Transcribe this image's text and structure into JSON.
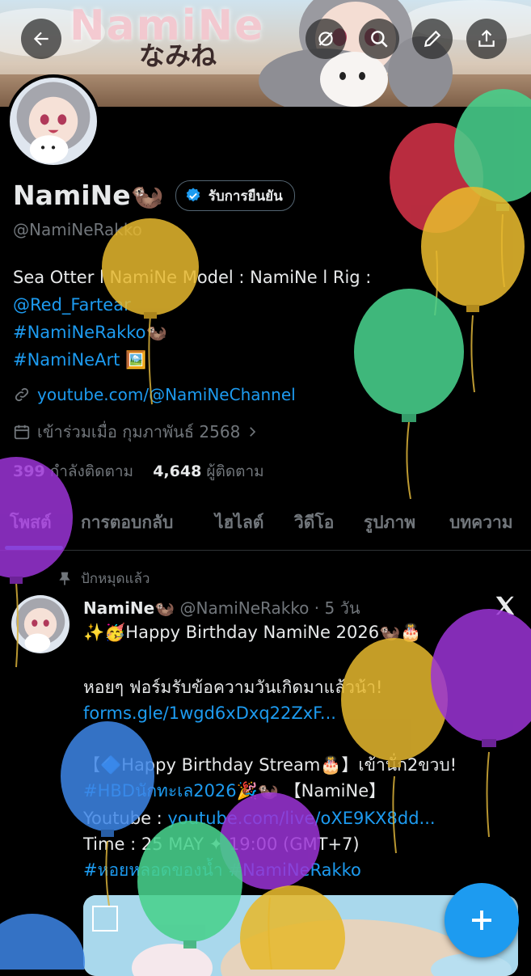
{
  "banner": {
    "title": "NamiNe",
    "subtitle": "なみね"
  },
  "top_bar": {
    "back_icon": "arrow-left-icon",
    "actions": [
      "mute-icon",
      "search-icon",
      "edit-icon",
      "share-icon"
    ]
  },
  "profile": {
    "display_name": "NamiNe🦦",
    "verified_label": "รับการยืนยัน",
    "handle": "@NamiNeRakko",
    "bio": {
      "line1": "Sea Otter l NamiNe Model : NamiNe l Rig :",
      "mention": "@Red_Fartear",
      "hashtag1": "#NamiNeRakko",
      "hashtag1_suffix": "🦦",
      "hashtag2": "#NamiNeArt",
      "hashtag2_suffix": "🖼️"
    },
    "website": "youtube.com/@NamiNeChannel",
    "joined": "เข้าร่วมเมื่อ กุมภาพันธ์ 2568",
    "following_count": "399",
    "following_label": "กำลังติดตาม",
    "followers_count": "4,648",
    "followers_label": "ผู้ติดตาม"
  },
  "tabs": [
    "โพสต์",
    "การตอบกลับ",
    "ไฮไลต์",
    "วิดีโอ",
    "รูปภาพ",
    "บทความ"
  ],
  "pinned_label": "ปักหมุดแล้ว",
  "post": {
    "author_name": "NamiNe🦦",
    "author_handle": "@NamiNeRakko",
    "separator": "·",
    "time": "5 วัน",
    "line1": "✨🥳Happy Birthday NamiNe 2026🦦🎂",
    "line2": "หอยๆ ฟอร์มรับข้อความวันเกิดมาแล้วน้า!",
    "link1": "forms.gle/1wgd6xDxq22ZxF...",
    "line3": "【🔷Happy Birthday Stream🎂】เข้านั่ก2ขวบ!",
    "line4_hashtag": "#HBDนักทะเล2026",
    "line4_rest": "🎉🦦 【NamiNe】",
    "line5_prefix": "Youtube : ",
    "link2": "youtube.com/live/oXE9KX8dd...",
    "line6": "Time : 25 MAY ✦ 19:00 (GMT+7)",
    "line7_hashtag1": "#หอยหลอดของน้ำ",
    "line7_hashtag2": "#NamiNeRakko"
  },
  "fab_icon": "plus-icon",
  "colors": {
    "accent": "#1d9bf0",
    "background": "#000000",
    "muted": "#71767b"
  }
}
